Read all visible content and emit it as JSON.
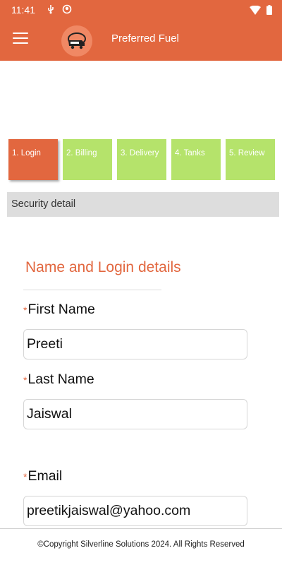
{
  "status_bar": {
    "time": "11:41",
    "icons_left": [
      "usb-debug-icon",
      "recording-icon"
    ],
    "icons_right": [
      "wifi-icon",
      "battery-icon"
    ]
  },
  "app_bar": {
    "title": "Preferred Fuel",
    "menu_icon": "hamburger-menu-icon",
    "logo": "preferred-fuel-logo",
    "color": "#E2673F"
  },
  "steps": [
    {
      "label": "1. Login",
      "active": true
    },
    {
      "label": "2. Billing",
      "active": false
    },
    {
      "label": "3. Delivery",
      "active": false
    },
    {
      "label": "4. Tanks",
      "active": false
    },
    {
      "label": "5. Review",
      "active": false
    }
  ],
  "step_colors": {
    "active": "#E2673F",
    "inactive": "#B5E36B"
  },
  "section": {
    "title": "Security detail"
  },
  "form": {
    "title": "Name and Login details",
    "required_marker": "*",
    "first_name": {
      "label": "First Name",
      "value": "Preeti"
    },
    "last_name": {
      "label": "Last Name",
      "value": "Jaiswal"
    },
    "email": {
      "label": "Email",
      "value": "preetikjaiswal@yahoo.com"
    }
  },
  "footer": {
    "text": "©Copyright Silverline Solutions 2024. All Rights Reserved"
  }
}
